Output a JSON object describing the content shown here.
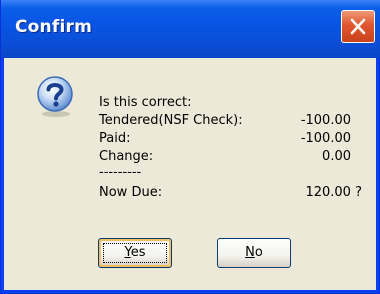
{
  "window": {
    "title": "Confirm",
    "close_label": "Close"
  },
  "message": {
    "question": "Is this correct:",
    "rows": [
      {
        "label": "Tendered(NSF Check):",
        "value": "-100.00"
      },
      {
        "label": "Paid:",
        "value": "-100.00"
      },
      {
        "label": "Change:",
        "value": "0.00"
      }
    ],
    "separator": "---------",
    "now_due_label": "Now Due:",
    "now_due_value": "120.00 ?"
  },
  "buttons": {
    "yes_mnemonic": "Y",
    "yes_rest": "es",
    "no_mnemonic": "N",
    "no_rest": "o"
  },
  "icons": {
    "dialog_icon": "question-icon",
    "close_icon": "close-icon"
  },
  "colors": {
    "titlebar": "#0a5fe8",
    "close_button": "#e0562f",
    "client_bg": "#ece9d8"
  }
}
